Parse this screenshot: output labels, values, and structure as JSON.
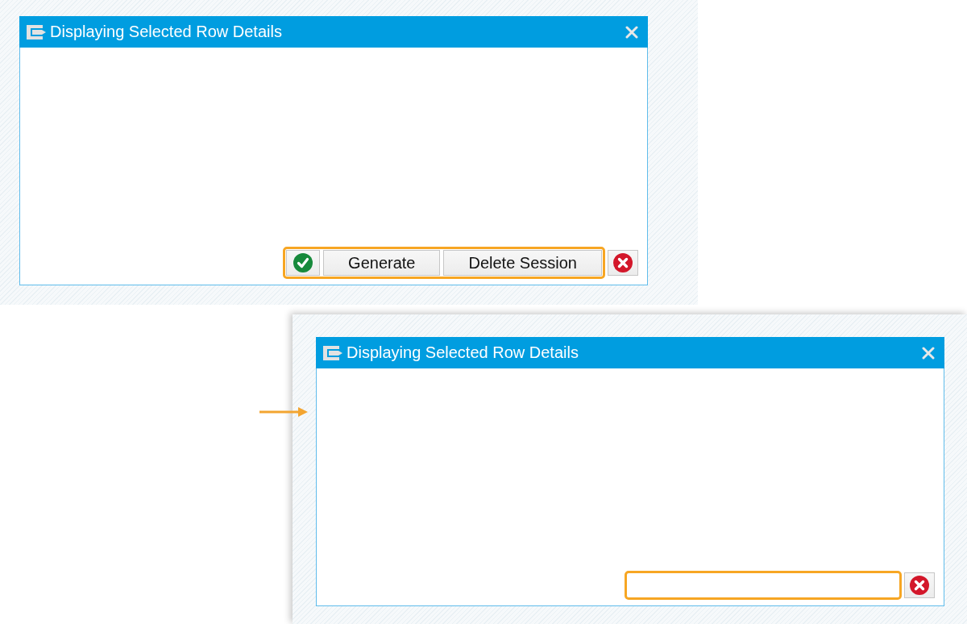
{
  "screenshots": [
    {
      "dialog": {
        "title": "Displaying Selected Row Details",
        "highlighted_buttons": [
          {
            "kind": "confirm"
          },
          {
            "kind": "text",
            "label": "Generate"
          },
          {
            "kind": "text",
            "label": "Delete Session"
          }
        ]
      }
    },
    {
      "dialog": {
        "title": "Displaying Selected Row Details"
      }
    }
  ]
}
